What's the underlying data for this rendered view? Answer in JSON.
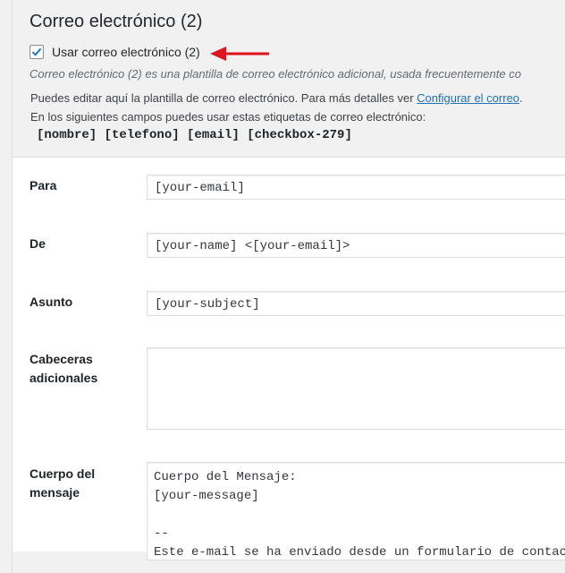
{
  "section": {
    "title": "Correo electrónico (2)"
  },
  "use_mail": {
    "label": "Usar correo electrónico (2)",
    "checked": true
  },
  "description": "Correo electrónico (2) es una plantilla de correo electrónico adicional, usada frecuentemente co",
  "help": {
    "line1_prefix": "Puedes editar aquí la plantilla de correo electrónico. Para más detalles ver ",
    "line1_link": "Configurar el correo",
    "line1_suffix": ".",
    "line2": "En los siguientes campos puedes usar estas etiquetas de correo electrónico:",
    "tags": " [nombre] [telefono] [email] [checkbox-279]"
  },
  "fields": {
    "to": {
      "label": "Para",
      "value": "[your-email]"
    },
    "from": {
      "label": "De",
      "value": "[your-name] <[your-email]>"
    },
    "subject": {
      "label": "Asunto",
      "value": "[your-subject]"
    },
    "headers": {
      "label_line1": "Cabeceras",
      "label_line2": "adicionales",
      "value": ""
    },
    "body": {
      "label_line1": "Cuerpo del",
      "label_line2": "mensaje",
      "value": "Cuerpo del Mensaje:\n[your-message]\n\n--\nEste e-mail se ha enviado desde un formulario de contacto"
    }
  },
  "colors": {
    "arrow": "#e0141e",
    "link": "#2271b1",
    "check": "#2271b1"
  }
}
